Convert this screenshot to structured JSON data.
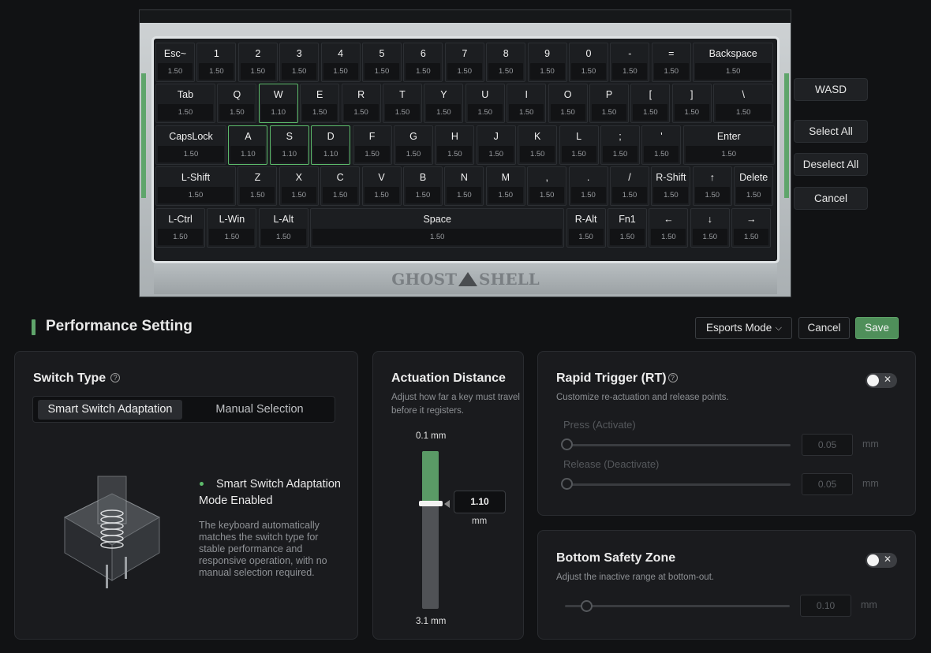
{
  "keyboard": {
    "brand_logo": "GHOST SHELL",
    "rows": [
      [
        {
          "label": "Esc~",
          "value": "1.50"
        },
        {
          "label": "1",
          "value": "1.50"
        },
        {
          "label": "2",
          "value": "1.50"
        },
        {
          "label": "3",
          "value": "1.50"
        },
        {
          "label": "4",
          "value": "1.50"
        },
        {
          "label": "5",
          "value": "1.50"
        },
        {
          "label": "6",
          "value": "1.50"
        },
        {
          "label": "7",
          "value": "1.50"
        },
        {
          "label": "8",
          "value": "1.50"
        },
        {
          "label": "9",
          "value": "1.50"
        },
        {
          "label": "0",
          "value": "1.50"
        },
        {
          "label": "-",
          "value": "1.50"
        },
        {
          "label": "=",
          "value": "1.50"
        },
        {
          "label": "Backspace",
          "value": "1.50"
        }
      ],
      [
        {
          "label": "Tab",
          "value": "1.50"
        },
        {
          "label": "Q",
          "value": "1.50"
        },
        {
          "label": "W",
          "value": "1.10",
          "selected": true
        },
        {
          "label": "E",
          "value": "1.50"
        },
        {
          "label": "R",
          "value": "1.50"
        },
        {
          "label": "T",
          "value": "1.50"
        },
        {
          "label": "Y",
          "value": "1.50"
        },
        {
          "label": "U",
          "value": "1.50"
        },
        {
          "label": "I",
          "value": "1.50"
        },
        {
          "label": "O",
          "value": "1.50"
        },
        {
          "label": "P",
          "value": "1.50"
        },
        {
          "label": "[",
          "value": "1.50"
        },
        {
          "label": "]",
          "value": "1.50"
        },
        {
          "label": "\\",
          "value": "1.50"
        }
      ],
      [
        {
          "label": "CapsLock",
          "value": "1.50"
        },
        {
          "label": "A",
          "value": "1.10",
          "selected": true
        },
        {
          "label": "S",
          "value": "1.10",
          "selected": true
        },
        {
          "label": "D",
          "value": "1.10",
          "selected": true
        },
        {
          "label": "F",
          "value": "1.50"
        },
        {
          "label": "G",
          "value": "1.50"
        },
        {
          "label": "H",
          "value": "1.50"
        },
        {
          "label": "J",
          "value": "1.50"
        },
        {
          "label": "K",
          "value": "1.50"
        },
        {
          "label": "L",
          "value": "1.50"
        },
        {
          "label": ";",
          "value": "1.50"
        },
        {
          "label": "'",
          "value": "1.50"
        },
        {
          "label": "Enter",
          "value": "1.50"
        }
      ],
      [
        {
          "label": "L-Shift",
          "value": "1.50"
        },
        {
          "label": "Z",
          "value": "1.50"
        },
        {
          "label": "X",
          "value": "1.50"
        },
        {
          "label": "C",
          "value": "1.50"
        },
        {
          "label": "V",
          "value": "1.50"
        },
        {
          "label": "B",
          "value": "1.50"
        },
        {
          "label": "N",
          "value": "1.50"
        },
        {
          "label": "M",
          "value": "1.50"
        },
        {
          "label": ",",
          "value": "1.50"
        },
        {
          "label": ".",
          "value": "1.50"
        },
        {
          "label": "/",
          "value": "1.50"
        },
        {
          "label": "R-Shift",
          "value": "1.50"
        },
        {
          "label": "↑",
          "value": "1.50"
        },
        {
          "label": "Delete",
          "value": "1.50"
        }
      ],
      [
        {
          "label": "L-Ctrl",
          "value": "1.50"
        },
        {
          "label": "L-Win",
          "value": "1.50"
        },
        {
          "label": "L-Alt",
          "value": "1.50"
        },
        {
          "label": "Space",
          "value": "1.50"
        },
        {
          "label": "R-Alt",
          "value": "1.50"
        },
        {
          "label": "Fn1",
          "value": "1.50"
        },
        {
          "label": "←",
          "value": "1.50"
        },
        {
          "label": "↓",
          "value": "1.50"
        },
        {
          "label": "→",
          "value": "1.50"
        }
      ]
    ]
  },
  "key_actions": {
    "wasd": "WASD",
    "select_all": "Select All",
    "deselect_all": "Deselect All",
    "cancel": "Cancel"
  },
  "performance": {
    "title": "Performance Setting",
    "mode": "Esports Mode",
    "cancel": "Cancel",
    "save": "Save"
  },
  "switch_type": {
    "title": "Switch Type",
    "options": [
      "Smart Switch Adaptation",
      "Manual Selection"
    ],
    "selected": "Smart Switch Adaptation",
    "status_title": "Smart Switch Adaptation Mode Enabled",
    "status_desc": "The keyboard automatically matches the switch type for stable performance and responsive operation, with no manual selection required."
  },
  "actuation": {
    "title": "Actuation Distance",
    "desc": "Adjust how far a key must travel before it registers.",
    "min_label": "0.1 mm",
    "max_label": "3.1 mm",
    "min": 0.1,
    "max": 3.1,
    "value": "1.10",
    "unit": "mm"
  },
  "rapid_trigger": {
    "title": "Rapid Trigger (RT)",
    "desc": "Customize re-actuation and release points.",
    "enabled": false,
    "press_label": "Press (Activate)",
    "press_value": "0.05",
    "release_label": "Release (Deactivate)",
    "release_value": "0.05",
    "unit": "mm"
  },
  "bottom_safety": {
    "title": "Bottom Safety Zone",
    "desc": "Adjust the inactive range at bottom-out.",
    "enabled": false,
    "value": "0.10",
    "unit": "mm"
  },
  "colors": {
    "accent_green": "#5a9a66",
    "background": "#111214",
    "panel": "#1a1b1e"
  }
}
